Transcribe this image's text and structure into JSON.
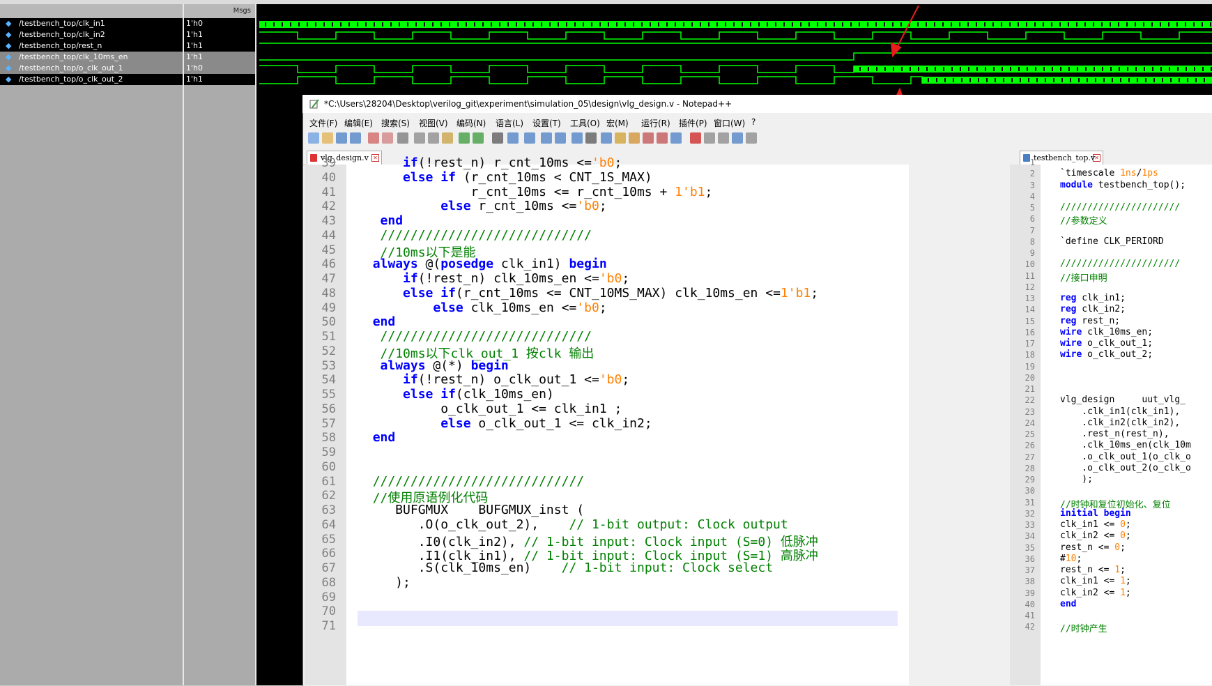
{
  "wave_window": {
    "msgs_header": "Msgs",
    "signals": [
      {
        "name": "/testbench_top/clk_in1",
        "value": "1'h0"
      },
      {
        "name": "/testbench_top/clk_in2",
        "value": "1'h1"
      },
      {
        "name": "/testbench_top/rest_n",
        "value": "1'h1"
      },
      {
        "name": "/testbench_top/clk_10ms_en",
        "value": "1'h1"
      },
      {
        "name": "/testbench_top/o_clk_out_1",
        "value": "1'h0"
      },
      {
        "name": "/testbench_top/o_clk_out_2",
        "value": "1'h1"
      }
    ],
    "wave_color": "#00ff00"
  },
  "notepad": {
    "title": "*C:\\Users\\28204\\Desktop\\verilog_git\\experiment\\simulation_05\\design\\vlg_design.v - Notepad++",
    "menu": [
      "文件(F)",
      "编辑(E)",
      "搜索(S)",
      "视图(V)",
      "编码(N)",
      "语言(L)",
      "设置(T)",
      "工具(O)",
      "宏(M)",
      "运行(R)",
      "插件(P)",
      "窗口(W)",
      "?"
    ],
    "left_tab": "vlg_design.v",
    "right_tab": "testbench_top.v",
    "left_lines": [
      {
        "n": "39",
        "t": "      if(!rest_n) r_cnt_10ms <='b0;"
      },
      {
        "n": "40",
        "t": "      else if (r_cnt_10ms < CNT_1S_MAX)"
      },
      {
        "n": "41",
        "t": "               r_cnt_10ms <= r_cnt_10ms + 1'b1;"
      },
      {
        "n": "42",
        "t": "           else r_cnt_10ms <='b0;"
      },
      {
        "n": "43",
        "t": "   end"
      },
      {
        "n": "44",
        "t": "   ////////////////////////////"
      },
      {
        "n": "45",
        "t": "   //10ms以下是能"
      },
      {
        "n": "46",
        "t": "  always @(posedge clk_in1) begin"
      },
      {
        "n": "47",
        "t": "      if(!rest_n) clk_10ms_en <='b0;"
      },
      {
        "n": "48",
        "t": "      else if(r_cnt_10ms <= CNT_10MS_MAX) clk_10ms_en <=1'b1;"
      },
      {
        "n": "49",
        "t": "          else clk_10ms_en <='b0;"
      },
      {
        "n": "50",
        "t": "  end"
      },
      {
        "n": "51",
        "t": "   ////////////////////////////"
      },
      {
        "n": "52",
        "t": "   //10ms以下clk_out_1 按clk 输出"
      },
      {
        "n": "53",
        "t": "   always @(*) begin"
      },
      {
        "n": "54",
        "t": "      if(!rest_n) o_clk_out_1 <='b0;"
      },
      {
        "n": "55",
        "t": "      else if(clk_10ms_en)"
      },
      {
        "n": "56",
        "t": "           o_clk_out_1 <= clk_in1 ;"
      },
      {
        "n": "57",
        "t": "           else o_clk_out_1 <= clk_in2;"
      },
      {
        "n": "58",
        "t": "  end"
      },
      {
        "n": "59",
        "t": ""
      },
      {
        "n": "60",
        "t": ""
      },
      {
        "n": "61",
        "t": "  ////////////////////////////"
      },
      {
        "n": "62",
        "t": "  //使用原语例化代码"
      },
      {
        "n": "63",
        "t": "     BUFGMUX    BUFGMUX_inst ("
      },
      {
        "n": "64",
        "t": "        .O(o_clk_out_2),    // 1-bit output: Clock output"
      },
      {
        "n": "65",
        "t": "        .I0(clk_in2), // 1-bit input: Clock input (S=0) 低脉冲"
      },
      {
        "n": "66",
        "t": "        .I1(clk_in1), // 1-bit input: Clock input (S=1) 高脉冲"
      },
      {
        "n": "67",
        "t": "        .S(clk_10ms_en)    // 1-bit input: Clock select"
      },
      {
        "n": "68",
        "t": "     );"
      },
      {
        "n": "69",
        "t": ""
      },
      {
        "n": "70",
        "t": ""
      },
      {
        "n": "71",
        "t": ""
      }
    ],
    "right_lines": [
      {
        "n": "1",
        "t": ""
      },
      {
        "n": "2",
        "t": "`timescale 1ns/1ps"
      },
      {
        "n": "3",
        "t": "module testbench_top();"
      },
      {
        "n": "4",
        "t": ""
      },
      {
        "n": "5",
        "t": "//////////////////////"
      },
      {
        "n": "6",
        "t": "//参数定义"
      },
      {
        "n": "7",
        "t": ""
      },
      {
        "n": "8",
        "t": "`define CLK_PERIORD"
      },
      {
        "n": "9",
        "t": ""
      },
      {
        "n": "10",
        "t": "//////////////////////"
      },
      {
        "n": "11",
        "t": "//接口申明"
      },
      {
        "n": "12",
        "t": ""
      },
      {
        "n": "13",
        "t": "reg clk_in1;"
      },
      {
        "n": "14",
        "t": "reg clk_in2;"
      },
      {
        "n": "15",
        "t": "reg rest_n;"
      },
      {
        "n": "16",
        "t": "wire clk_10ms_en;"
      },
      {
        "n": "17",
        "t": "wire o_clk_out_1;"
      },
      {
        "n": "18",
        "t": "wire o_clk_out_2;"
      },
      {
        "n": "19",
        "t": ""
      },
      {
        "n": "20",
        "t": ""
      },
      {
        "n": "21",
        "t": ""
      },
      {
        "n": "22",
        "t": "vlg_design     uut_vlg_"
      },
      {
        "n": "23",
        "t": "    .clk_in1(clk_in1),"
      },
      {
        "n": "24",
        "t": "    .clk_in2(clk_in2),"
      },
      {
        "n": "25",
        "t": "    .rest_n(rest_n),"
      },
      {
        "n": "26",
        "t": "    .clk_10ms_en(clk_10m"
      },
      {
        "n": "27",
        "t": "    .o_clk_out_1(o_clk_o"
      },
      {
        "n": "28",
        "t": "    .o_clk_out_2(o_clk_o"
      },
      {
        "n": "29",
        "t": "    );"
      },
      {
        "n": "30",
        "t": ""
      },
      {
        "n": "31",
        "t": "//时钟和复位初始化、复位"
      },
      {
        "n": "32",
        "t": "initial begin"
      },
      {
        "n": "33",
        "t": "clk_in1 <= 0;"
      },
      {
        "n": "34",
        "t": "clk_in2 <= 0;"
      },
      {
        "n": "35",
        "t": "rest_n <= 0;"
      },
      {
        "n": "36",
        "t": "#10;"
      },
      {
        "n": "37",
        "t": "rest_n <= 1;"
      },
      {
        "n": "38",
        "t": "clk_in1 <= 1;"
      },
      {
        "n": "39",
        "t": "clk_in2 <= 1;"
      },
      {
        "n": "40",
        "t": "end"
      },
      {
        "n": "41",
        "t": ""
      },
      {
        "n": "42",
        "t": "//时钟产生"
      }
    ]
  }
}
